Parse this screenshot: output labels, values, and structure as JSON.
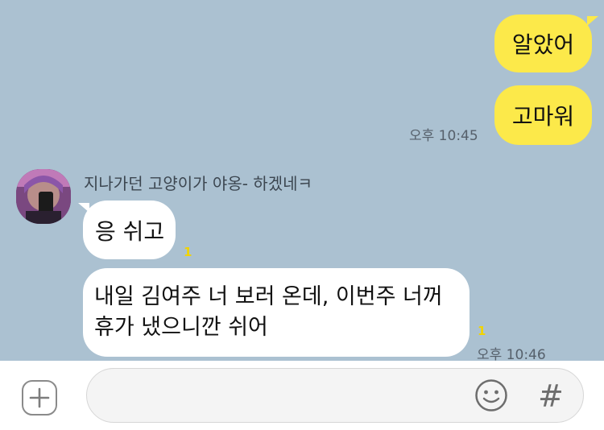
{
  "messages_sent": [
    {
      "text": "알았어"
    },
    {
      "text": "고마워",
      "time": "오후 10:45"
    }
  ],
  "incoming": {
    "sender_name": "지나가던 고양이가 야옹- 하겠네ㅋ",
    "msg1": {
      "text": "응 쉬고",
      "unread": "1"
    },
    "msg2": {
      "line1": "내일 김여주 너 보러 온데, 이번주 너꺼",
      "line2": "휴가 냈으니깐 쉬어",
      "unread": "1",
      "time": "오후 10:46"
    }
  },
  "input_bar": {
    "hash_label": "#",
    "add_icon": "plus-square-icon",
    "emoji_icon": "smile-icon"
  },
  "colors": {
    "chat_bg": "#abc1d1",
    "my_bubble": "#fce94a",
    "other_bubble": "#ffffff"
  }
}
